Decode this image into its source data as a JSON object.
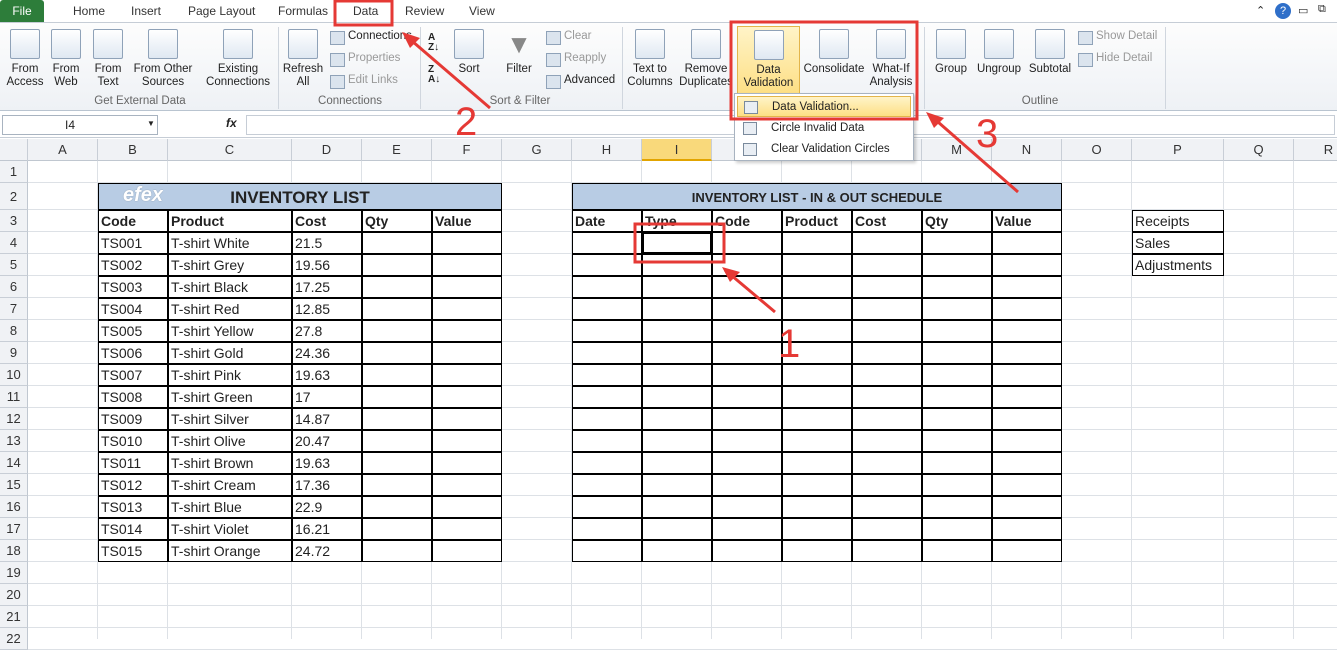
{
  "tabs": {
    "file": "File",
    "items": [
      "Home",
      "Insert",
      "Page Layout",
      "Formulas",
      "Data",
      "Review",
      "View"
    ],
    "active": "Data"
  },
  "ribbon": {
    "get_external": {
      "from_access": "From Access",
      "from_web": "From Web",
      "from_text": "From Text",
      "from_other": "From Other Sources",
      "existing": "Existing Connections",
      "label": "Get External Data"
    },
    "connections": {
      "refresh": "Refresh All",
      "connections": "Connections",
      "properties": "Properties",
      "edit_links": "Edit Links",
      "label": "Connections"
    },
    "sort_filter": {
      "sort": "Sort",
      "filter": "Filter",
      "clear": "Clear",
      "reapply": "Reapply",
      "advanced": "Advanced",
      "label": "Sort & Filter"
    },
    "data_tools": {
      "text_to_columns": "Text to Columns",
      "remove_duplicates": "Remove Duplicates",
      "data_validation": "Data Validation",
      "consolidate": "Consolidate",
      "what_if": "What-If Analysis"
    },
    "outline": {
      "group": "Group",
      "ungroup": "Ungroup",
      "subtotal": "Subtotal",
      "show_detail": "Show Detail",
      "hide_detail": "Hide Detail",
      "label": "Outline"
    }
  },
  "dropdown": {
    "items": [
      "Data Validation...",
      "Circle Invalid Data",
      "Clear Validation Circles"
    ],
    "highlighted": "Data Validation..."
  },
  "formula_bar": {
    "name_box": "I4",
    "fx": "fx",
    "value": ""
  },
  "sheet": {
    "columns": [
      "A",
      "B",
      "C",
      "D",
      "E",
      "F",
      "G",
      "H",
      "I",
      "J",
      "K",
      "L",
      "M",
      "N",
      "O",
      "P",
      "Q",
      "R"
    ],
    "selected_column": "I",
    "selected_cell": "I4",
    "rows": [
      "1",
      "2",
      "3",
      "4",
      "5",
      "6",
      "7",
      "8",
      "9",
      "10",
      "11",
      "12",
      "13",
      "14",
      "15",
      "16",
      "17",
      "18",
      "19",
      "20",
      "21",
      "22"
    ],
    "inventory": {
      "title": "INVENTORY LIST",
      "logo": "efex",
      "headers": [
        "Code",
        "Product",
        "Cost",
        "Qty",
        "Value"
      ],
      "items": [
        [
          "TS001",
          "T-shirt White",
          "21.5"
        ],
        [
          "TS002",
          "T-shirt Grey",
          "19.56"
        ],
        [
          "TS003",
          "T-shirt Black",
          "17.25"
        ],
        [
          "TS004",
          "T-shirt Red",
          "12.85"
        ],
        [
          "TS005",
          "T-shirt Yellow",
          "27.8"
        ],
        [
          "TS006",
          "T-shirt Gold",
          "24.36"
        ],
        [
          "TS007",
          "T-shirt Pink",
          "19.63"
        ],
        [
          "TS008",
          "T-shirt Green",
          "17"
        ],
        [
          "TS009",
          "T-shirt Silver",
          "14.87"
        ],
        [
          "TS010",
          "T-shirt Olive",
          "20.47"
        ],
        [
          "TS011",
          "T-shirt Brown",
          "19.63"
        ],
        [
          "TS012",
          "T-shirt Cream",
          "17.36"
        ],
        [
          "TS013",
          "T-shirt Blue",
          "22.9"
        ],
        [
          "TS014",
          "T-shirt Violet",
          "16.21"
        ],
        [
          "TS015",
          "T-shirt Orange",
          "24.72"
        ]
      ]
    },
    "schedule": {
      "title": "INVENTORY LIST - IN & OUT SCHEDULE",
      "headers": [
        "Date",
        "Type",
        "Code",
        "Product",
        "Cost",
        "Qty",
        "Value"
      ]
    },
    "types": [
      "Receipts",
      "Sales",
      "Adjustments"
    ]
  },
  "annotations": {
    "step1": "1",
    "step2": "2",
    "step3": "3",
    "color": "#e53935"
  }
}
